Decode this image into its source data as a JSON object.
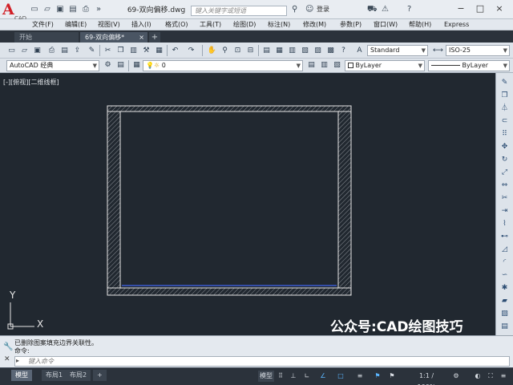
{
  "app": {
    "logo_letter": "A",
    "logo_sub": "CAD",
    "document_title": "69-双向偏移.dwg",
    "search_placeholder": "键入关键字或短语",
    "login_label": "登录",
    "help_label": "?"
  },
  "quick_access": {
    "icons": [
      "new-icon",
      "open-icon",
      "save-icon",
      "save-as-icon",
      "print-icon",
      "undo-icon",
      "redo-icon",
      "more-icon"
    ]
  },
  "menu": {
    "items": [
      "文件(F)",
      "编辑(E)",
      "视图(V)",
      "插入(I)",
      "格式(O)",
      "工具(T)",
      "绘图(D)",
      "标注(N)",
      "修改(M)",
      "参数(P)",
      "窗口(W)",
      "帮助(H)",
      "Express"
    ]
  },
  "tabs": {
    "items": [
      {
        "label": "开始",
        "active": false
      },
      {
        "label": "69-双向偏移*",
        "active": true
      }
    ],
    "close_glyph": "×",
    "add_glyph": "+"
  },
  "toolbar": {
    "text_style": "Standard",
    "dim_style": "ISO-25",
    "workspace": "AutoCAD 经典",
    "layer_name": "0",
    "color": "ByLayer",
    "linetype": "ByLayer"
  },
  "canvas": {
    "view_label": "[-][俯视][二维线框]",
    "watermark": "公众号:CAD绘图技巧",
    "ucs_x": "X",
    "ucs_y": "Y",
    "background": "#212830",
    "selection_color": "#3a5bd0"
  },
  "command": {
    "history": [
      "已删除图案填充边界关联性。",
      "命令:"
    ],
    "input_placeholder": "键入命令"
  },
  "status": {
    "layout_tabs": [
      {
        "label": "模型",
        "active": true
      },
      {
        "label": "布局1",
        "active": false
      },
      {
        "label": "布局2",
        "active": false
      }
    ],
    "add_layout": "+",
    "model_label": "模型",
    "scale": "1:1 / 100%"
  }
}
